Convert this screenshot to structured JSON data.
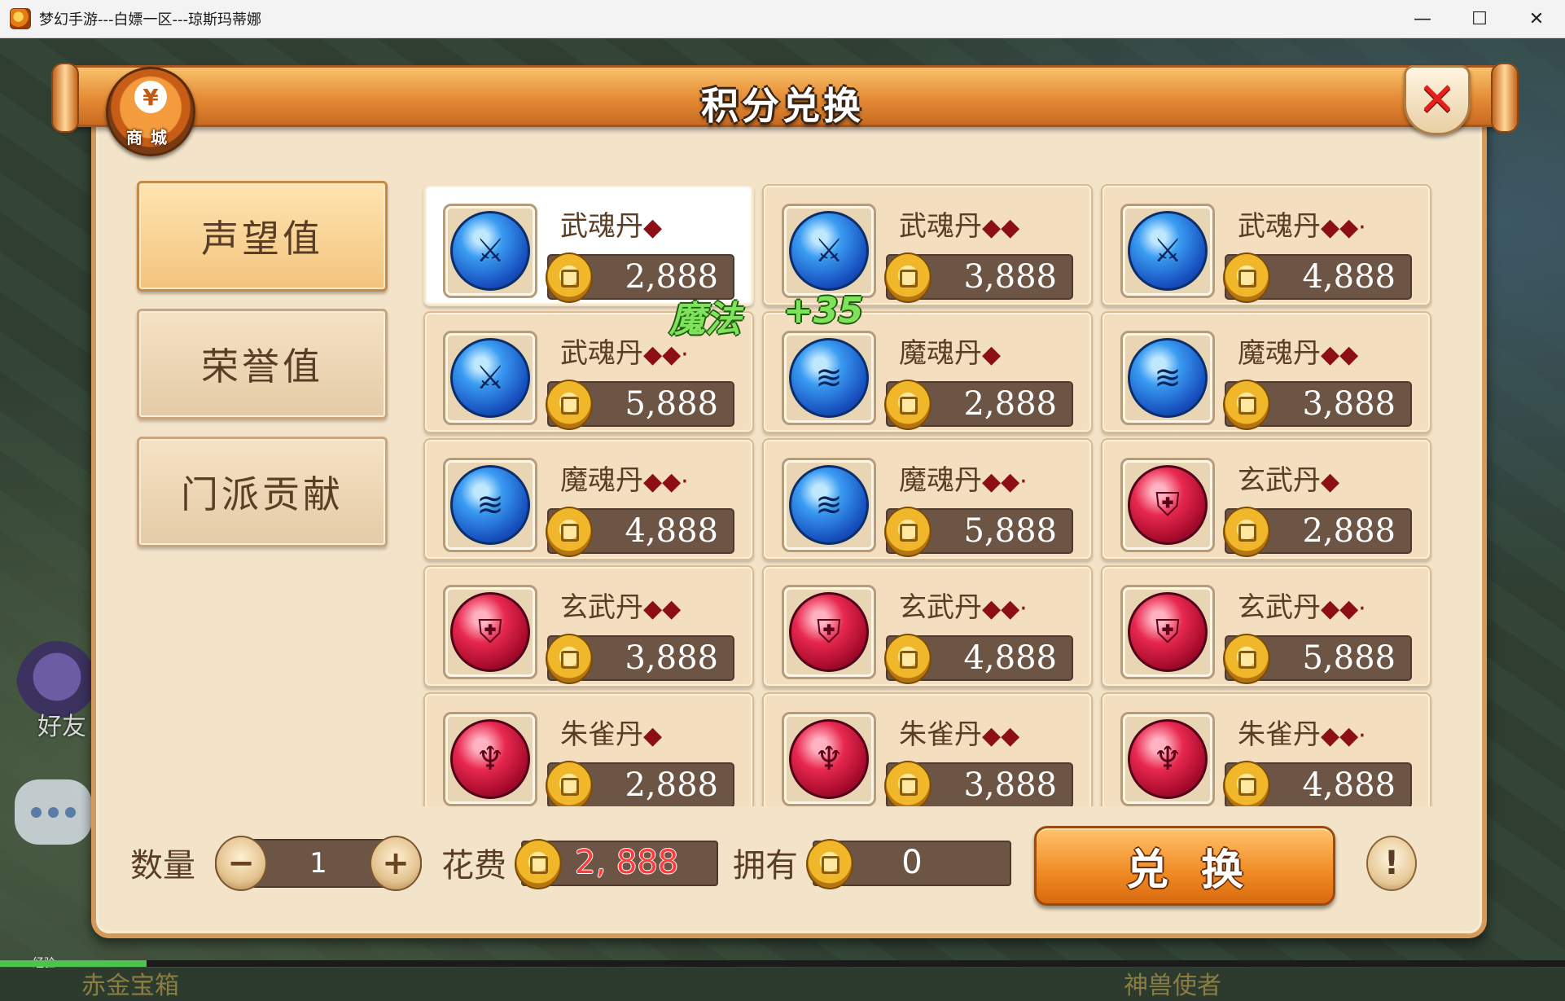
{
  "window": {
    "title": "梦幻手游---白嫖一区---琼斯玛蒂娜",
    "minimize": "—",
    "maximize": "☐",
    "close": "✕"
  },
  "scene": {
    "friend_label": "好友",
    "exp_label": "经验",
    "bottom_left_text": "赤金宝箱",
    "bottom_right_text": "神兽使者"
  },
  "dialog": {
    "title": "积分兑换",
    "badge_label": "商城",
    "close_label": "✕"
  },
  "tabs": [
    {
      "label": "声望值",
      "active": true
    },
    {
      "label": "荣誉值",
      "active": false
    },
    {
      "label": "门派贡献",
      "active": false
    }
  ],
  "floating": {
    "magic": "魔法",
    "bonus": "+35"
  },
  "items": [
    {
      "name": "武魂丹",
      "diamonds": "◆",
      "price": "2,888",
      "icon": "blue-sword-orb-icon",
      "selected": true
    },
    {
      "name": "武魂丹",
      "diamonds": "◆◆",
      "price": "3,888",
      "icon": "blue-sword-orb-icon"
    },
    {
      "name": "武魂丹",
      "diamonds": "◆◆·",
      "price": "4,888",
      "icon": "blue-sword-orb-icon"
    },
    {
      "name": "武魂丹",
      "diamonds": "◆◆·",
      "price": "5,888",
      "icon": "blue-sword-orb-icon"
    },
    {
      "name": "魔魂丹",
      "diamonds": "◆",
      "price": "2,888",
      "icon": "blue-wave-orb-icon"
    },
    {
      "name": "魔魂丹",
      "diamonds": "◆◆",
      "price": "3,888",
      "icon": "blue-wave-orb-icon"
    },
    {
      "name": "魔魂丹",
      "diamonds": "◆◆·",
      "price": "4,888",
      "icon": "blue-wave-orb-icon"
    },
    {
      "name": "魔魂丹",
      "diamonds": "◆◆·",
      "price": "5,888",
      "icon": "blue-wave-orb-icon"
    },
    {
      "name": "玄武丹",
      "diamonds": "◆",
      "price": "2,888",
      "icon": "red-shield-orb-icon"
    },
    {
      "name": "玄武丹",
      "diamonds": "◆◆",
      "price": "3,888",
      "icon": "red-shield-orb-icon"
    },
    {
      "name": "玄武丹",
      "diamonds": "◆◆·",
      "price": "4,888",
      "icon": "red-shield-orb-icon"
    },
    {
      "name": "玄武丹",
      "diamonds": "◆◆·",
      "price": "5,888",
      "icon": "red-shield-orb-icon"
    },
    {
      "name": "朱雀丹",
      "diamonds": "◆",
      "price": "2,888",
      "icon": "red-bird-orb-icon"
    },
    {
      "name": "朱雀丹",
      "diamonds": "◆◆",
      "price": "3,888",
      "icon": "red-bird-orb-icon"
    },
    {
      "name": "朱雀丹",
      "diamonds": "◆◆·",
      "price": "4,888",
      "icon": "red-bird-orb-icon"
    }
  ],
  "footer": {
    "quantity_label": "数量",
    "quantity_value": "1",
    "minus": "−",
    "plus": "+",
    "cost_label": "花费",
    "cost_value": "2, 888",
    "own_label": "拥有",
    "own_value": "0",
    "exchange_label": "兑换",
    "info": "!"
  },
  "colors": {
    "panel_bg": "#f3e3c9",
    "banner_orange": "#e48a34",
    "price_bar": "#6d5545",
    "cost_red": "#ff3b3b",
    "diamond_red": "#8b0f14"
  }
}
